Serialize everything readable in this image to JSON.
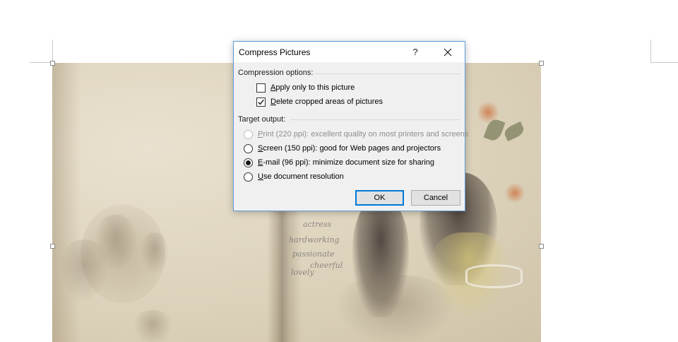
{
  "dialog": {
    "title": "Compress Pictures",
    "help_label": "?",
    "compression_options_label": "Compression options:",
    "options": [
      {
        "accel": "A",
        "rest": "pply only to this picture",
        "checked": false
      },
      {
        "accel": "D",
        "rest": "elete cropped areas of pictures",
        "checked": true
      }
    ],
    "target_output_label": "Target output:",
    "targets": [
      {
        "accel": "P",
        "rest": "rint (220 ppi): excellent quality on most printers and screens",
        "selected": false,
        "disabled": true
      },
      {
        "accel": "S",
        "rest": "creen (150 ppi): good for Web pages and projectors",
        "selected": false,
        "disabled": false
      },
      {
        "accel": "E",
        "rest": "-mail (96 ppi): minimize document size for sharing",
        "selected": true,
        "disabled": false
      },
      {
        "accel": "U",
        "rest": "se document resolution",
        "selected": false,
        "disabled": false
      }
    ],
    "ok_label": "OK",
    "cancel_label": "Cancel"
  },
  "picture": {
    "handwriting": [
      "actress",
      "hardworking",
      "passionate",
      "cheerful",
      "lovely"
    ]
  },
  "colors": {
    "dialog_border": "#5b9bd5",
    "default_button_border": "#0078d7",
    "dialog_background": "#f0f0f0"
  }
}
